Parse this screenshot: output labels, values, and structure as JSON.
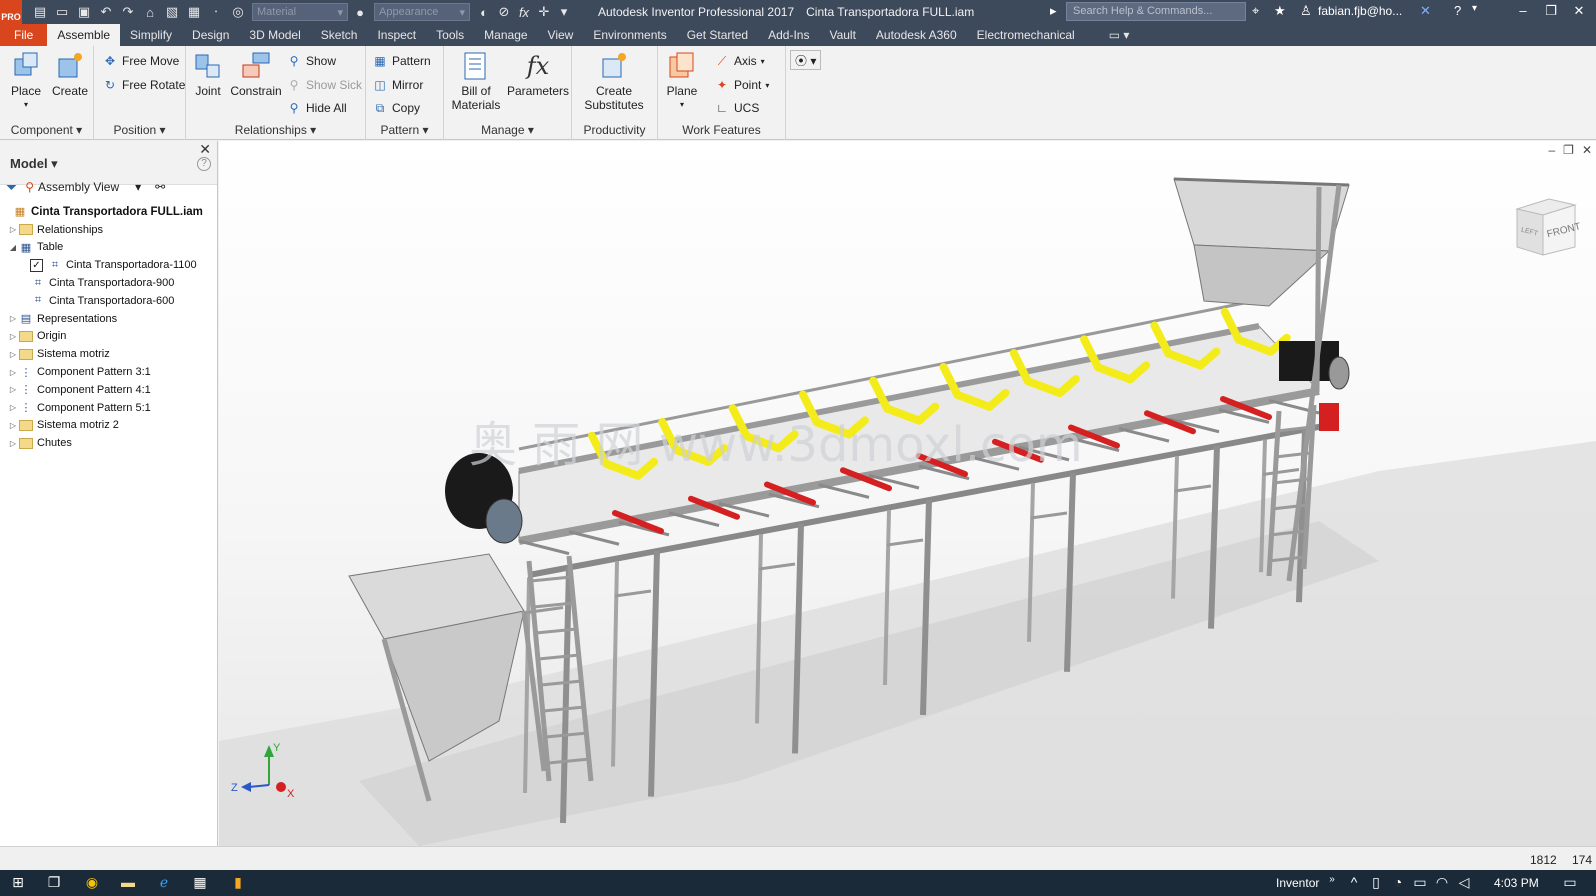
{
  "titlebar": {
    "logo": "PRO",
    "material_placeholder": "Material",
    "appearance_placeholder": "Appearance",
    "app_title": "Autodesk Inventor Professional 2017",
    "file_name": "Cinta Transportadora FULL.iam",
    "search_placeholder": "Search Help & Commands...",
    "user": "fabian.fjb@ho..."
  },
  "tabs": [
    "File",
    "Assemble",
    "Simplify",
    "Design",
    "3D Model",
    "Sketch",
    "Inspect",
    "Tools",
    "Manage",
    "View",
    "Environments",
    "Get Started",
    "Add-Ins",
    "Vault",
    "Autodesk A360",
    "Electromechanical"
  ],
  "active_tab": "Assemble",
  "ribbon": {
    "component": {
      "label": "Component",
      "place": "Place",
      "create": "Create"
    },
    "position": {
      "label": "Position",
      "free_move": "Free Move",
      "free_rotate": "Free Rotate"
    },
    "relationships": {
      "label": "Relationships",
      "joint": "Joint",
      "constrain": "Constrain",
      "show": "Show",
      "show_sick": "Show Sick",
      "hide_all": "Hide All"
    },
    "pattern": {
      "label": "Pattern",
      "pattern": "Pattern",
      "mirror": "Mirror",
      "copy": "Copy"
    },
    "manage": {
      "label": "Manage",
      "bom_line1": "Bill of",
      "bom_line2": "Materials",
      "parameters": "Parameters"
    },
    "productivity": {
      "label": "Productivity",
      "create_sub_line1": "Create",
      "create_sub_line2": "Substitutes"
    },
    "work_features": {
      "label": "Work Features",
      "plane": "Plane",
      "axis": "Axis",
      "point": "Point",
      "ucs": "UCS"
    }
  },
  "browser": {
    "title": "Model",
    "view": "Assembly View",
    "tree": [
      {
        "label": "Cinta Transportadora FULL.iam",
        "level": 0,
        "icon": "assembly-icon",
        "expander": ""
      },
      {
        "label": "Relationships",
        "level": 1,
        "icon": "folder-icon",
        "expander": "▷"
      },
      {
        "label": "Table",
        "level": 1,
        "icon": "table-icon",
        "expander": "◢"
      },
      {
        "label": "Cinta Transportadora-1100",
        "level": 2,
        "icon": "assembly-small-icon",
        "expander": "",
        "checked": true
      },
      {
        "label": "Cinta Transportadora-900",
        "level": 2,
        "icon": "assembly-small-icon",
        "expander": ""
      },
      {
        "label": "Cinta Transportadora-600",
        "level": 2,
        "icon": "assembly-small-icon",
        "expander": ""
      },
      {
        "label": "Representations",
        "level": 1,
        "icon": "representations-icon",
        "expander": "▷"
      },
      {
        "label": "Origin",
        "level": 1,
        "icon": "folder-icon",
        "expander": "▷"
      },
      {
        "label": "Sistema motriz",
        "level": 1,
        "icon": "folder-icon",
        "expander": "▷"
      },
      {
        "label": "Component Pattern 3:1",
        "level": 1,
        "icon": "pattern-icon",
        "expander": "▷"
      },
      {
        "label": "Component Pattern 4:1",
        "level": 1,
        "icon": "pattern-icon",
        "expander": "▷"
      },
      {
        "label": "Component Pattern 5:1",
        "level": 1,
        "icon": "pattern-icon",
        "expander": "▷"
      },
      {
        "label": "Sistema motriz 2",
        "level": 1,
        "icon": "folder-icon",
        "expander": "▷"
      },
      {
        "label": "Chutes",
        "level": 1,
        "icon": "folder-icon",
        "expander": "▷"
      }
    ]
  },
  "viewport": {
    "viewcube_front": "FRONT",
    "viewcube_left": "LEFT",
    "watermark": "奥 雨 网 www.3dmoxl.com",
    "axis_x": "X",
    "axis_y": "Y",
    "axis_z": "Z"
  },
  "status": {
    "value1": "1812",
    "value2": "174"
  },
  "taskbar": {
    "app_label": "Inventor",
    "time": "4:03 PM"
  },
  "colors": {
    "titlebar": "#3d4a5c",
    "file_tab": "#d9451c",
    "roller": "#f3ec1a",
    "return_roller": "#d42020",
    "frame": "#9a9a9a"
  }
}
